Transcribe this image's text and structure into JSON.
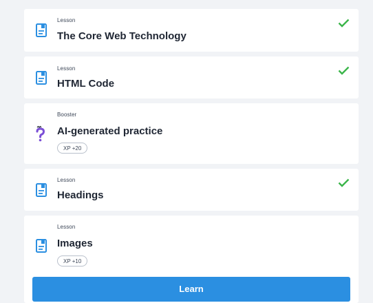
{
  "items": [
    {
      "kind": "Lesson",
      "title": "The Core Web Technology",
      "completed": true,
      "icon": "lesson-document-icon"
    },
    {
      "kind": "Lesson",
      "title": "HTML Code",
      "completed": true,
      "icon": "lesson-document-icon"
    },
    {
      "kind": "Booster",
      "title": "AI-generated practice",
      "completed": false,
      "xp": "XP +20",
      "icon": "question-mark-icon"
    },
    {
      "kind": "Lesson",
      "title": "Headings",
      "completed": true,
      "icon": "lesson-document-icon"
    },
    {
      "kind": "Lesson",
      "title": "Images",
      "completed": false,
      "xp": "XP +10",
      "icon": "lesson-document-icon"
    }
  ],
  "learn_button": {
    "label": "Learn"
  },
  "colors": {
    "accent": "#2b8fe1",
    "check": "#3bb54a",
    "booster": "#7b4fd6",
    "background": "#f1f3f6"
  }
}
